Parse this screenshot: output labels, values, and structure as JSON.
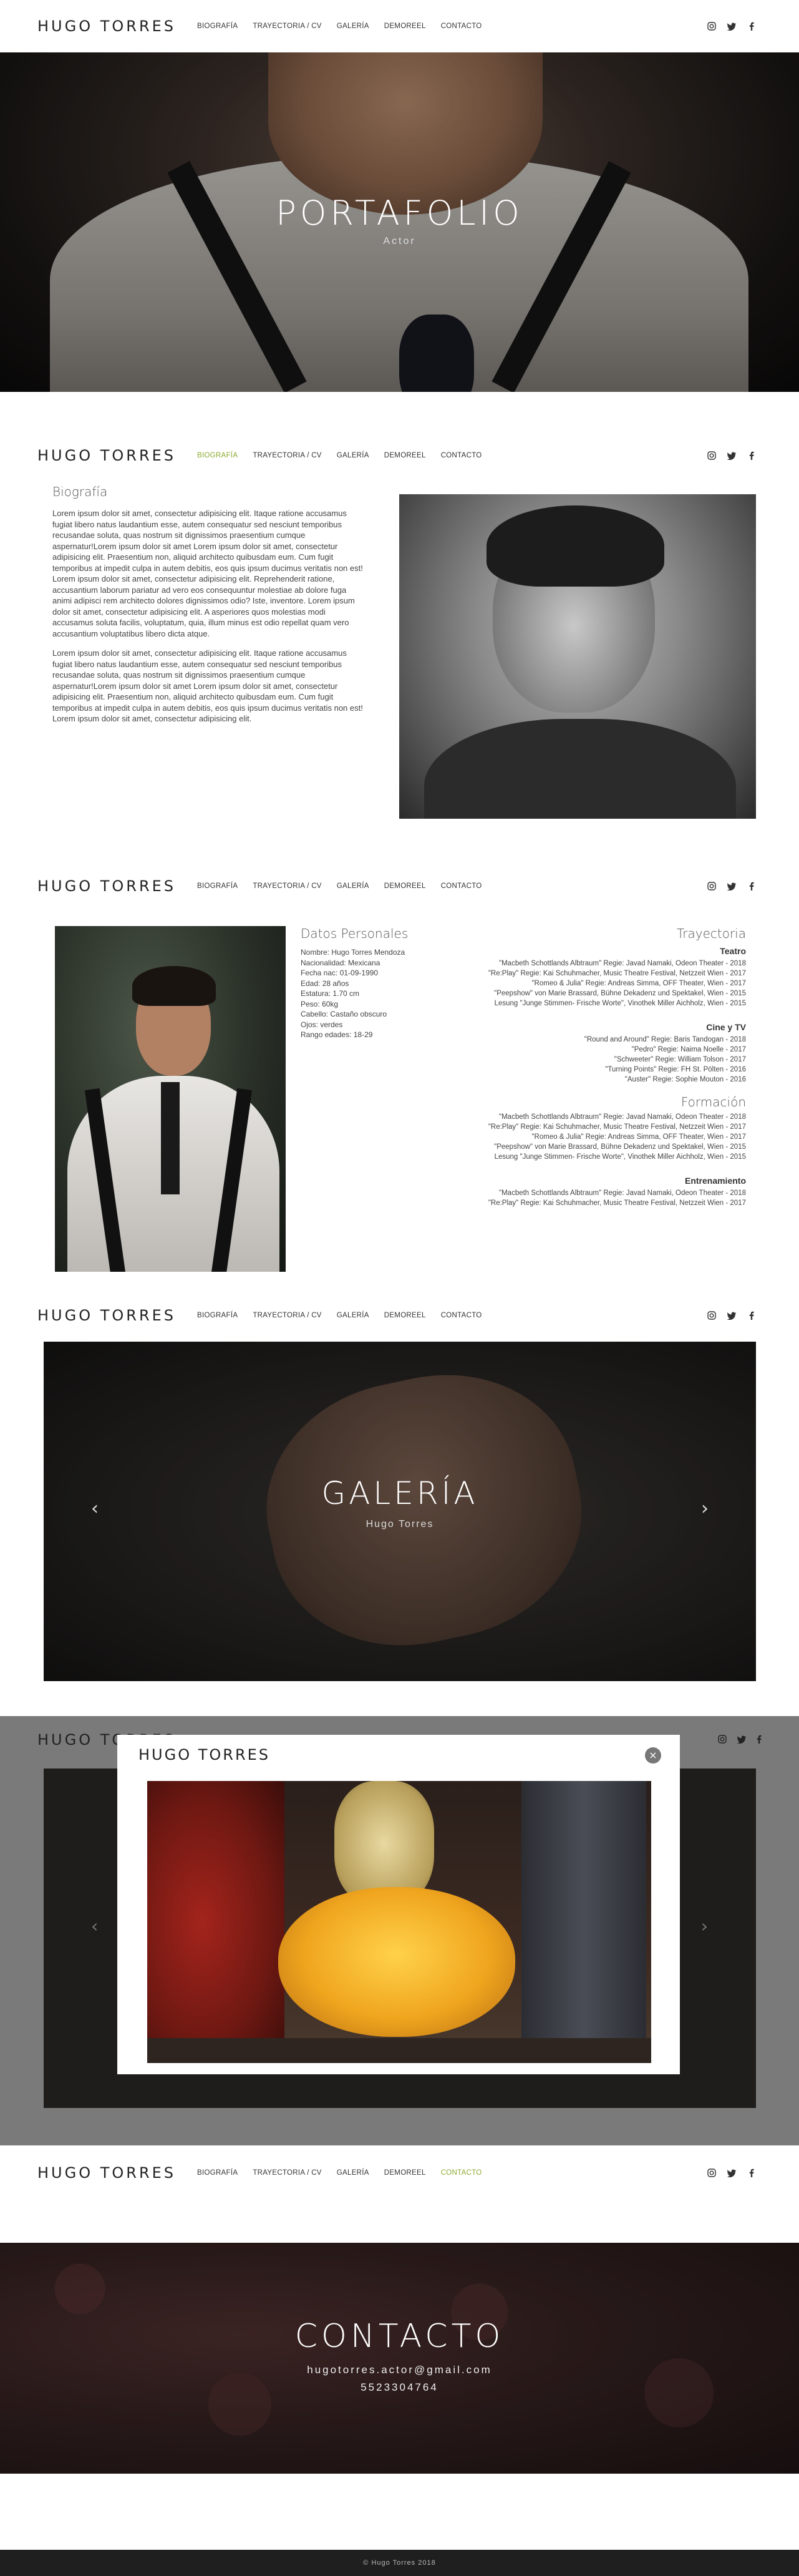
{
  "brand": "HUGO TORRES",
  "nav": [
    "BIOGRAFÍA",
    "TRAYECTORIA / CV",
    "GALERÍA",
    "DEMOREEL",
    "CONTACTO"
  ],
  "social_icons": [
    "instagram-icon",
    "twitter-icon",
    "facebook-icon"
  ],
  "accent_color": "#8aaa2f",
  "hero": {
    "title": "PORTAFOLIO",
    "subtitle": "Actor"
  },
  "bio": {
    "title": "Biografía",
    "p1": "Lorem ipsum dolor sit amet, consectetur adipisicing elit. Itaque ratione accusamus fugiat libero natus laudantium esse, autem consequatur sed nesciunt temporibus recusandae soluta, quas nostrum sit dignissimos praesentium cumque aspernatur!Lorem ipsum dolor sit amet Lorem ipsum dolor sit amet, consectetur adipisicing elit. Praesentium non, aliquid architecto quibusdam eum. Cum fugit temporibus at impedit culpa in autem debitis, eos quis ipsum ducimus veritatis non est! Lorem ipsum dolor sit amet, consectetur adipisicing elit. Reprehenderit ratione, accusantium laborum pariatur ad vero eos consequuntur molestiae ab dolore fuga animi adipisci rem architecto dolores dignissimos odio? Iste, inventore. Lorem ipsum dolor sit amet, consectetur adipisicing elit. A asperiores quos molestias modi accusamus soluta facilis, voluptatum, quia, illum minus est odio repellat quam vero accusantium voluptatibus libero dicta atque.",
    "p2": "Lorem ipsum dolor sit amet, consectetur adipisicing elit. Itaque ratione accusamus fugiat libero natus laudantium esse, autem consequatur sed nesciunt temporibus recusandae soluta, quas nostrum sit dignissimos praesentium cumque aspernatur!Lorem ipsum dolor sit amet Lorem ipsum dolor sit amet, consectetur adipisicing elit. Praesentium non, aliquid architecto quibusdam eum. Cum fugit temporibus at impedit culpa in autem debitis, eos quis ipsum ducimus veritatis non est! Lorem ipsum dolor sit amet, consectetur adipisicing elit."
  },
  "datos": {
    "title": "Datos Personales",
    "items": [
      "Nombre: Hugo Torres Mendoza",
      "Nacionalidad: Mexicana",
      "Fecha nac: 01-09-1990",
      "Edad: 28 años",
      "Estatura: 1.70 cm",
      "Peso: 60kg",
      "Cabello: Castaño obscuro",
      "Ojos: verdes",
      "Rango edades: 18-29"
    ]
  },
  "trayectoria": {
    "title": "Trayectoria",
    "teatro_title": "Teatro",
    "teatro": [
      "\"Macbeth Schottlands Albtraum\" Regie: Javad Namaki, Odeon Theater - 2018",
      "\"Re:Play\" Regie: Kai Schuhmacher, Music Theatre Festival, Netzzeit Wien - 2017",
      "\"Romeo & Julia\" Regie: Andreas Simma, OFF Theater, Wien - 2017",
      "\"Peepshow\" von Marie Brassard, Bühne Dekadenz und Spektakel, Wien - 2015",
      "Lesung \"Junge Stimmen- Frische Worte\", Vinothek Miller Aichholz, Wien - 2015"
    ],
    "cine_title": "Cine y TV",
    "cine": [
      "\"Round and Around\" Regie: Baris Tandogan - 2018",
      "\"Pedro\" Regie: Naima Noelle - 2017",
      "\"Schweeter\" Regie: William Tolson - 2017",
      "\"Turning Points\" Regie: FH St. Pölten - 2016",
      "\"Auster\" Regie: Sophie Mouton - 2016"
    ],
    "formacion_title": "Formación",
    "formacion": [
      "\"Macbeth Schottlands Albtraum\" Regie: Javad Namaki, Odeon Theater - 2018",
      "\"Re:Play\" Regie: Kai Schuhmacher, Music Theatre Festival, Netzzeit Wien - 2017",
      "\"Romeo & Julia\" Regie: Andreas Simma, OFF Theater, Wien - 2017",
      "\"Peepshow\" von Marie Brassard, Bühne Dekadenz und Spektakel, Wien - 2015",
      "Lesung \"Junge Stimmen- Frische Worte\", Vinothek Miller Aichholz, Wien - 2015"
    ],
    "entrenamiento_title": "Entrenamiento",
    "entrenamiento": [
      "\"Macbeth Schottlands Albtraum\" Regie: Javad Namaki, Odeon Theater - 2018",
      "\"Re:Play\" Regie: Kai Schuhmacher, Music Theatre Festival, Netzzeit Wien - 2017"
    ]
  },
  "galeria": {
    "title": "GALERÍA",
    "subtitle": "Hugo Torres",
    "prev": "‹",
    "next": "›"
  },
  "modal": {
    "title": "HUGO TORRES",
    "close": "×"
  },
  "contacto": {
    "title": "CONTACTO",
    "email": "hugotorres.actor@gmail.com",
    "phone": "5523304764"
  },
  "footer": "© Hugo Torres 2018"
}
